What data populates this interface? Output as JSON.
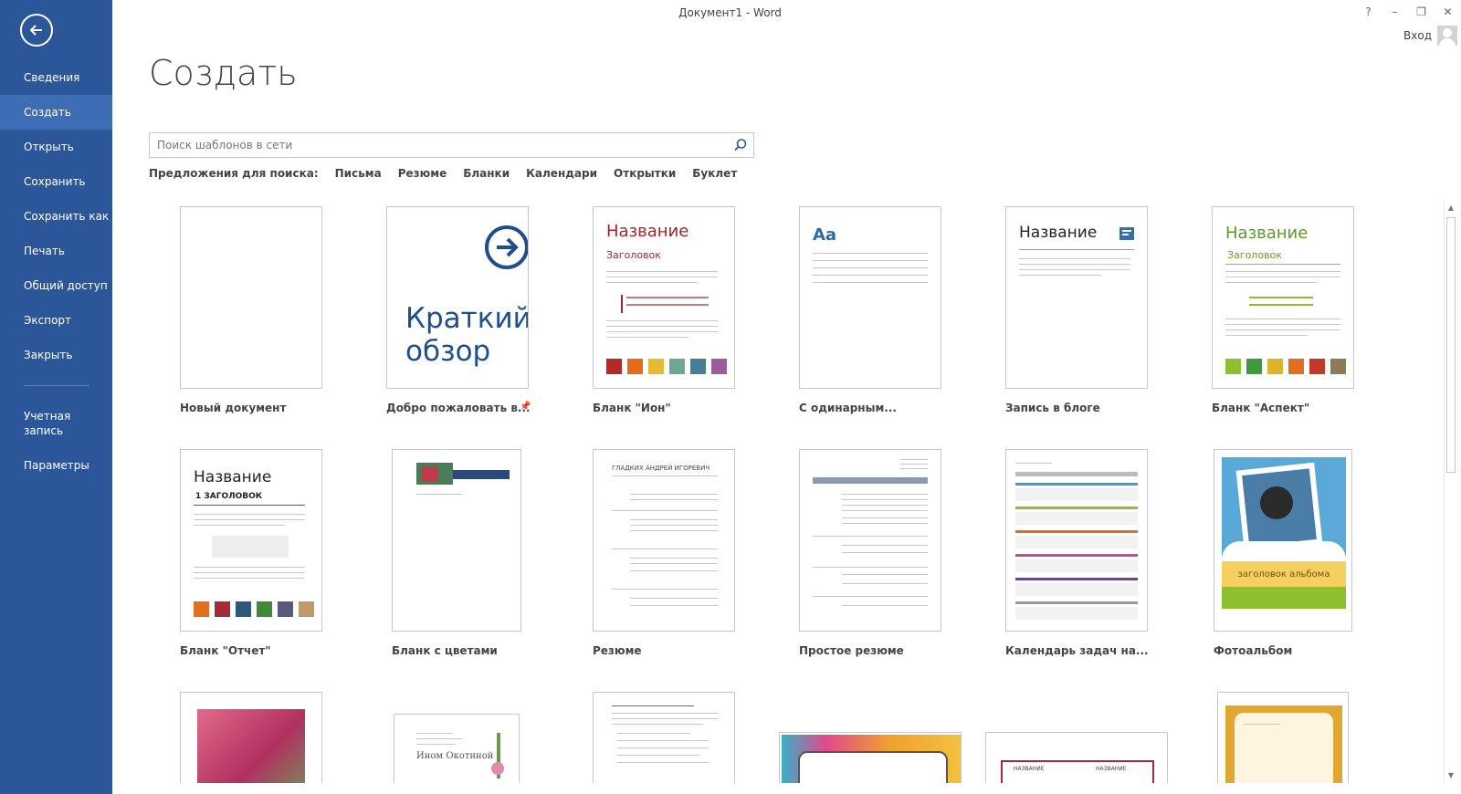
{
  "window": {
    "title": "Документ1 - Word",
    "help": "?",
    "minimize": "–",
    "restore": "❐",
    "close": "✕",
    "sign_in": "Вход"
  },
  "sidebar": {
    "items": [
      {
        "label": "Сведения"
      },
      {
        "label": "Создать",
        "active": true
      },
      {
        "label": "Открыть"
      },
      {
        "label": "Сохранить"
      },
      {
        "label": "Сохранить как"
      },
      {
        "label": "Печать"
      },
      {
        "label": "Общий доступ"
      },
      {
        "label": "Экспорт"
      },
      {
        "label": "Закрыть"
      }
    ],
    "bottom_items": [
      {
        "label": "Учетная запись"
      },
      {
        "label": "Параметры"
      }
    ]
  },
  "main": {
    "title": "Создать",
    "search": {
      "placeholder": "Поиск шаблонов в сети"
    },
    "suggestions": {
      "label": "Предложения для поиска:",
      "items": [
        "Письма",
        "Резюме",
        "Бланки",
        "Календари",
        "Открытки",
        "Буклет"
      ]
    },
    "templates": [
      {
        "label": "Новый документ"
      },
      {
        "label": "Добро пожаловать в...",
        "thumb_text": "Краткий обзор"
      },
      {
        "label": "Бланк \"Ион\"",
        "thumb_title": "Название",
        "thumb_heading": "Заголовок"
      },
      {
        "label": "С одинарным...",
        "thumb_text": "Aa"
      },
      {
        "label": "Запись в блоге",
        "thumb_title": "Название"
      },
      {
        "label": "Бланк \"Аспект\"",
        "thumb_title": "Название",
        "thumb_heading": "Заголовок"
      },
      {
        "label": "Бланк \"Отчет\"",
        "thumb_title": "Название",
        "thumb_heading": "1  ЗАГОЛОВОК"
      },
      {
        "label": "Бланк с цветами"
      },
      {
        "label": "Резюме",
        "thumb_title": "ГЛАДКИХ АНДРЕЙ ИГОРЕВИЧ"
      },
      {
        "label": "Простое резюме"
      },
      {
        "label": "Календарь задач на..."
      },
      {
        "label": "Фотоальбом",
        "thumb_text": "заголовок альбома"
      },
      {
        "thumb_text": ""
      },
      {
        "thumb_text": "Ином Окотиной"
      },
      {
        "thumb_text": ""
      },
      {
        "thumb_text": ""
      },
      {
        "thumb_text": "НАЗВАНИЕ"
      },
      {
        "thumb_text": ""
      }
    ],
    "swatches": {
      "ion": [
        "#b22a2a",
        "#e56c1e",
        "#e8b933",
        "#6da696",
        "#4a7c96",
        "#9b5d9e"
      ],
      "aspect": [
        "#8dbf2f",
        "#3e9a3a",
        "#e0b12a",
        "#e0701f",
        "#c0392b",
        "#8c7b55"
      ],
      "report": [
        "#e0701f",
        "#a52a3a",
        "#2b5a7c",
        "#3e8a3a",
        "#5a5a7c",
        "#c29a6a"
      ]
    },
    "colors": {
      "accent": "#2b579a",
      "blue_text": "#1e4e8c"
    }
  }
}
